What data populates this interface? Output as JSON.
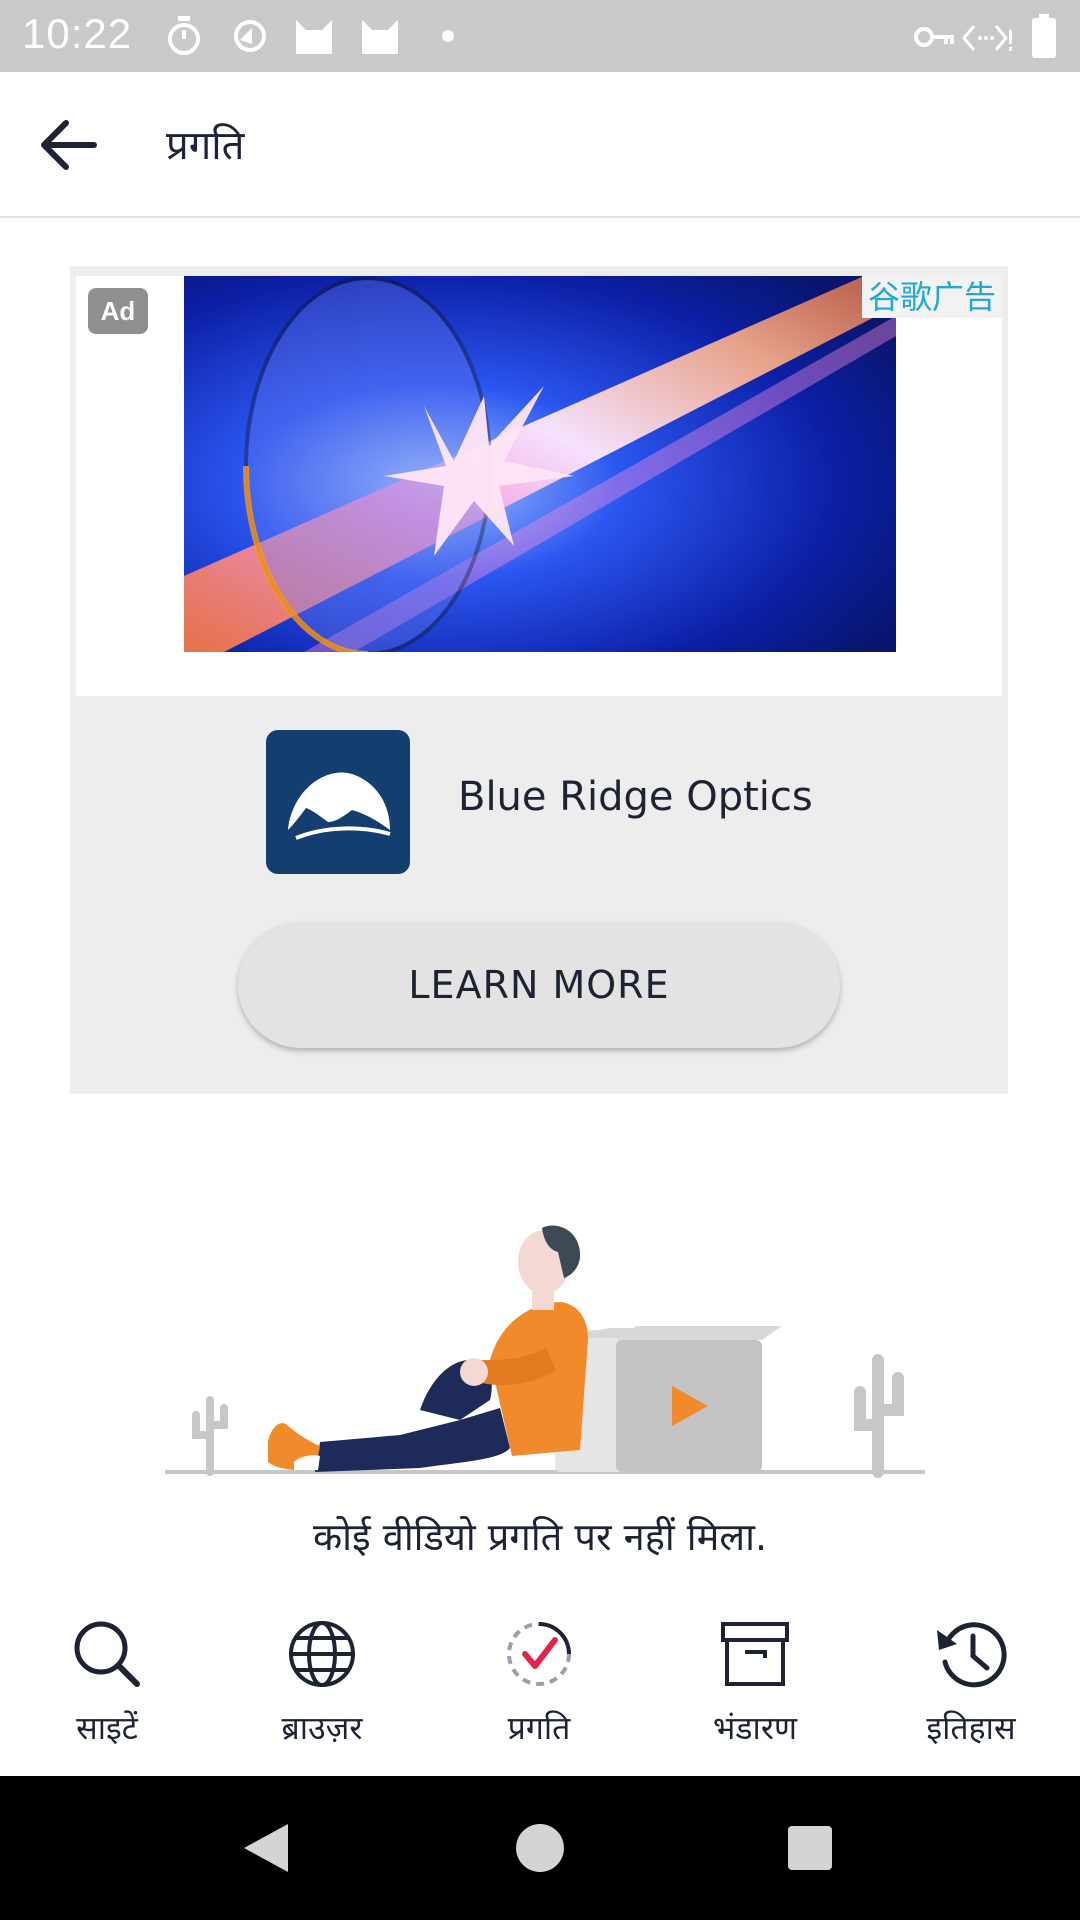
{
  "status_bar": {
    "time": "10:22"
  },
  "header": {
    "title": "प्रगति"
  },
  "ad": {
    "badge": "Ad",
    "provider": "谷歌广告",
    "brand": "Blue Ridge Optics",
    "cta": "LEARN MORE"
  },
  "empty_state": {
    "message": "कोई वीडियो प्रगति पर नहीं मिला."
  },
  "bottom_nav": {
    "items": [
      {
        "label": "साइटें",
        "icon": "search-icon"
      },
      {
        "label": "ब्राउज़र",
        "icon": "globe-icon"
      },
      {
        "label": "प्रगति",
        "icon": "progress-check-icon"
      },
      {
        "label": "भंडारण",
        "icon": "archive-icon"
      },
      {
        "label": "इतिहास",
        "icon": "history-icon"
      }
    ]
  },
  "colors": {
    "accent": "#e0244a",
    "text_primary": "#1d2333",
    "ad_provider": "#22a8d6",
    "brand_logo_bg": "#143d70"
  }
}
